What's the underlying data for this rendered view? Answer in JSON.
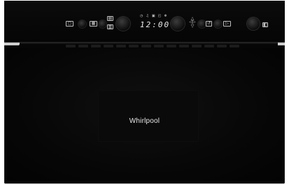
{
  "display": {
    "time": "12:00"
  },
  "brand": {
    "logo_text": "Whirlpool"
  },
  "icons": {
    "left_button_1": "square-icon",
    "left_button_2": "grid-icon",
    "left_mode_top": "microwave-icon",
    "left_mode_bottom": "grill-icon",
    "indicator_icons": [
      "clock-icon",
      "bell-icon",
      "lock-icon",
      "weight-icon",
      "defrost-icon"
    ],
    "dpad": "arrows-icon",
    "right_button_1": "back-icon",
    "right_button_2": "play-icon",
    "far_right": "door-open-icon"
  }
}
